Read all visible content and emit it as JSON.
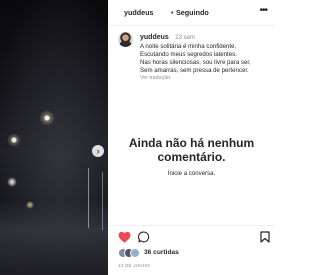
{
  "header": {
    "username": "yuddeus",
    "separator": "•",
    "follow_label": "Seguindo",
    "more_icon": "more-icon"
  },
  "caption": {
    "username": "yuddeus",
    "time": "23 sem",
    "lines": [
      "A noite solitária é minha confidente,",
      "Escutando meus segredos latentes.",
      "Nas horas silenciosas, sou livre para ser,",
      "Sem amarras, sem pressa de pertencer."
    ],
    "translate_label": "Ver tradução"
  },
  "comments_empty": {
    "title": "Ainda não há nenhum comentário.",
    "subtitle": "Inicie a conversa."
  },
  "actions": {
    "liked": true,
    "like_color": "#ed4956"
  },
  "likes": {
    "count_label": "36 curtidas"
  },
  "post_date": "13 DE JUNHO"
}
